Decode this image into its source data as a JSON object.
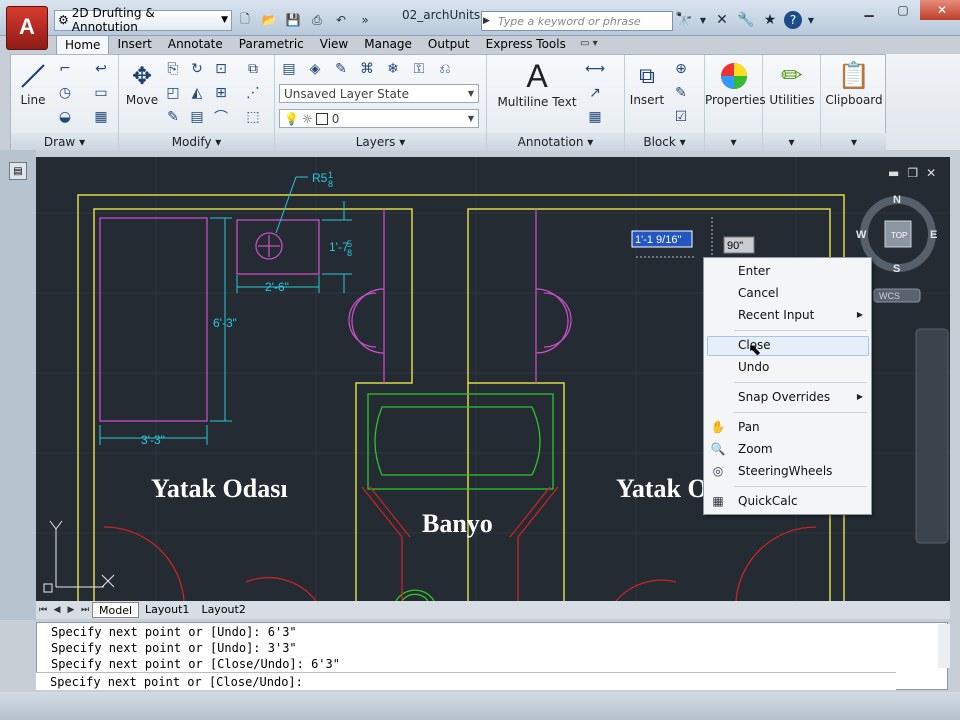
{
  "titlebar": {
    "logo": "A",
    "workspace": "2D Drufting & Annotution",
    "document": "02_archUnits...",
    "search_placeholder": "Type a keyword or phrase"
  },
  "ribbon_tabs": [
    "Home",
    "Insert",
    "Annotate",
    "Parametric",
    "View",
    "Manage",
    "Output",
    "Express Tools"
  ],
  "panels": {
    "draw": {
      "label": "Draw",
      "line": "Line"
    },
    "modify": {
      "label": "Modify",
      "move": "Move"
    },
    "layers": {
      "label": "Layers",
      "layer_state": "Unsaved Layer State",
      "layer_name": "0"
    },
    "annotation": {
      "label": "Annotation",
      "mtext": "Multiline Text",
      "mtext_icon": "A"
    },
    "block": {
      "label": "Block",
      "insert": "Insert"
    },
    "properties": {
      "label": "Properties"
    },
    "utilities": {
      "label": "Utilities"
    },
    "clipboard": {
      "label": "Clipboard"
    }
  },
  "drawing": {
    "dim_radius": "R5",
    "dim_radius_frac_num": "1",
    "dim_radius_frac_den": "8",
    "dim_height": "1'-7",
    "dim_height_frac_num": "5",
    "dim_height_frac_den": "8",
    "dim_width_small": "2'-6\"",
    "dim_vertical": "6'-3\"",
    "dim_horizontal": "3'-3\"",
    "room1": "Yatak Odası",
    "room2": "Banyo",
    "room3": "Yatak O",
    "input_length": "1'-1 9/16\"",
    "input_angle": "90\"",
    "compass": {
      "n": "N",
      "s": "S",
      "e": "E",
      "w": "W",
      "top": "TOP",
      "wcs": "WCS"
    },
    "ucs_y": "Y"
  },
  "context_menu": {
    "enter": "Enter",
    "cancel": "Cancel",
    "recent_input": "Recent Input",
    "close": "Close",
    "undo": "Undo",
    "snap_overrides": "Snap Overrides",
    "pan": "Pan",
    "zoom": "Zoom",
    "steering": "SteeringWheels",
    "quickcalc": "QuickCalc"
  },
  "layout_tabs": [
    "Model",
    "Layout1",
    "Layout2"
  ],
  "command_line": {
    "line1": "Specify next point or [Undo]: 6'3\"",
    "line2": "Specify next point or [Undo]: 3'3\"",
    "line3": "Specify next point or [Close/Undo]: 6'3\"",
    "prompt": "Specify next point or [Close/Undo]:"
  },
  "colors": {
    "background": "#252b33",
    "wall": "#d9d94a",
    "furniture": "#c44fc4",
    "dimension": "#28c8d8",
    "door": "#c82424",
    "fixture": "#2ec42e"
  }
}
